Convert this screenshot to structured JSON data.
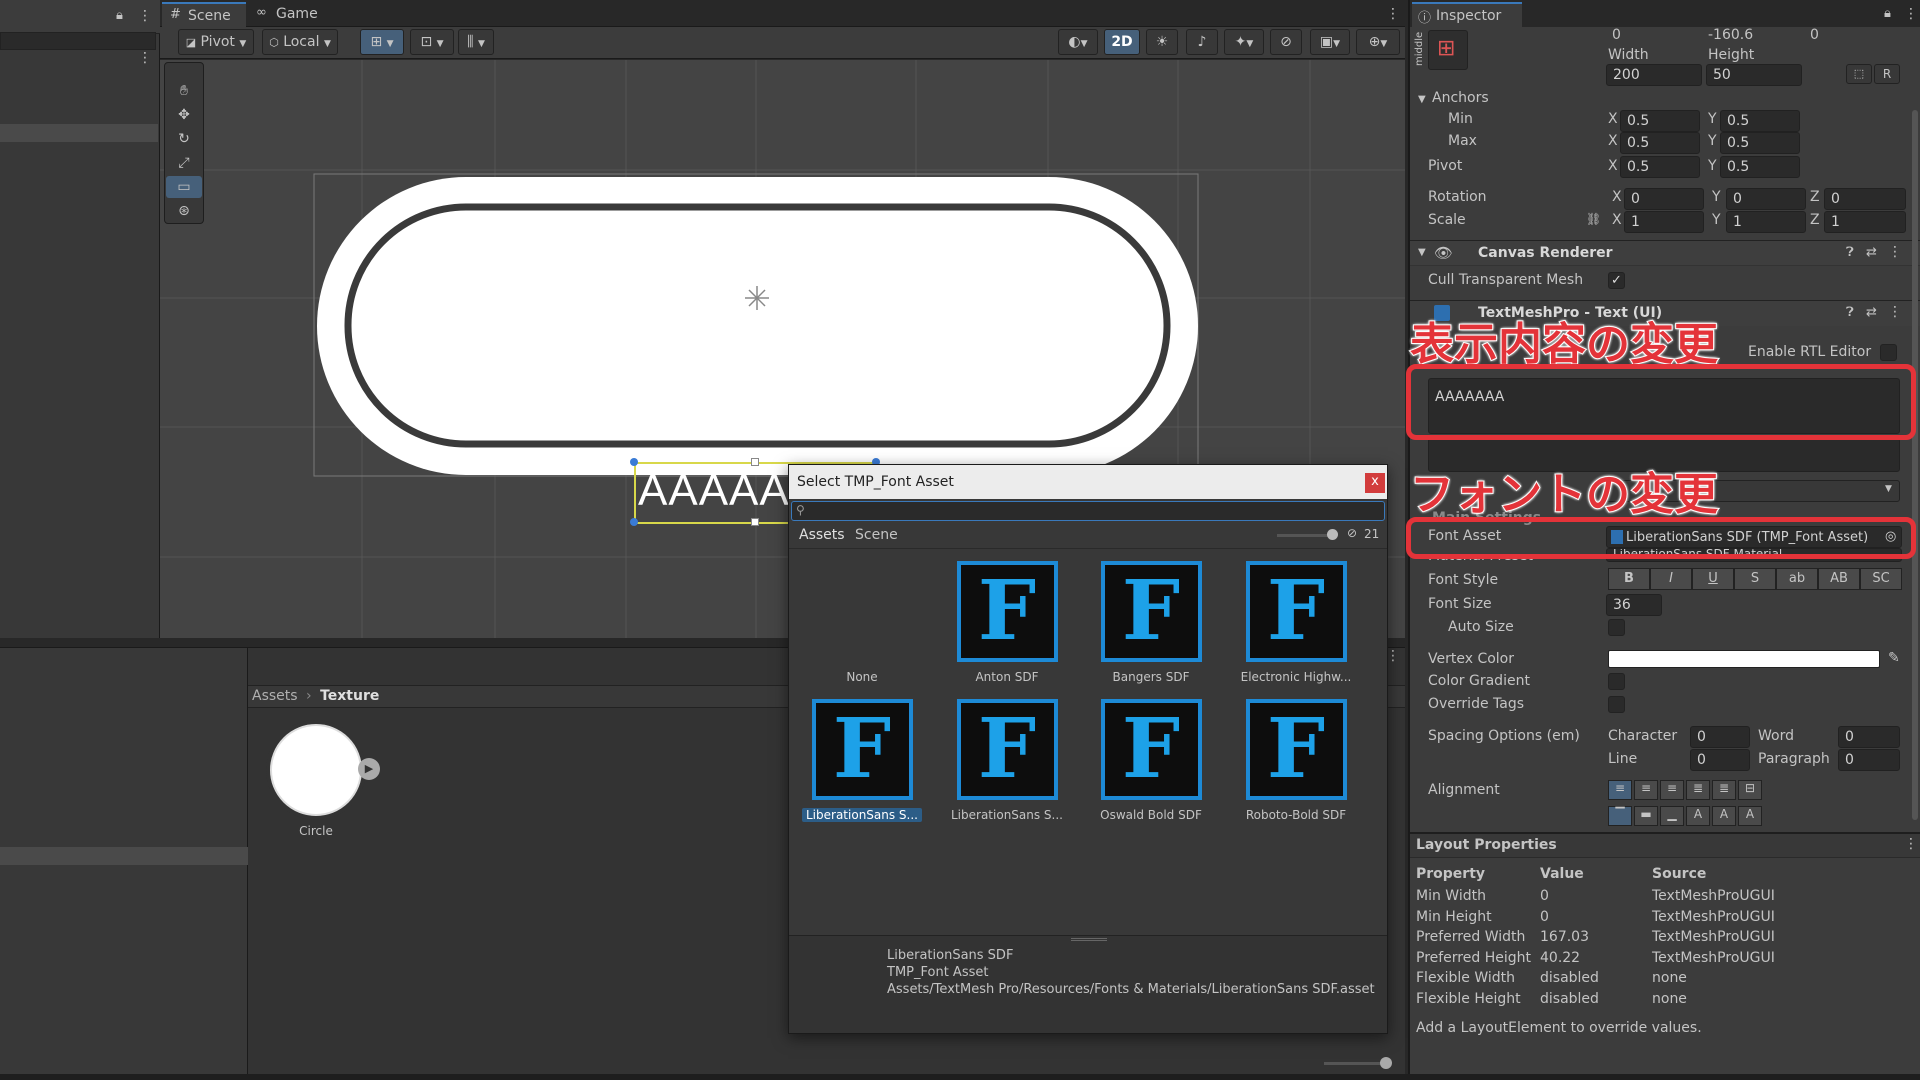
{
  "scene_tabs": {
    "scene": "Scene",
    "game": "Game"
  },
  "scene_toolbar": {
    "pivot": "Pivot",
    "local": "Local",
    "mode_2d": "2D"
  },
  "project": {
    "breadcrumb_root": "Assets",
    "breadcrumb_folder": "Texture",
    "item_label": "Circle"
  },
  "scene_text_object": "AAAAAAA",
  "picker": {
    "title": "Select TMP_Font Asset",
    "close": "x",
    "search_placeholder": "",
    "tab_assets": "Assets",
    "tab_scene": "Scene",
    "count": "21",
    "items": [
      {
        "label": "None",
        "icon": "F"
      },
      {
        "label": "Anton SDF",
        "icon": "F"
      },
      {
        "label": "Bangers SDF",
        "icon": "F"
      },
      {
        "label": "Electronic Highw...",
        "icon": "F"
      },
      {
        "label": "LiberationSans S...",
        "icon": "F"
      },
      {
        "label": "LiberationSans S...",
        "icon": "F"
      },
      {
        "label": "Oswald Bold SDF",
        "icon": "F"
      },
      {
        "label": "Roboto-Bold SDF",
        "icon": "F"
      }
    ],
    "info_name": "LiberationSans SDF",
    "info_type": "TMP_Font Asset",
    "info_path": "Assets/TextMesh Pro/Resources/Fonts & Materials/LiberationSans SDF.asset"
  },
  "inspector": {
    "title": "Inspector",
    "anchor_preset_label": "middle",
    "pos_values": [
      "0",
      "-160.6",
      "0"
    ],
    "width_label": "Width",
    "height_label": "Height",
    "width": "200",
    "height": "50",
    "r_button": "R",
    "anchors_label": "Anchors",
    "min_label": "Min",
    "max_label": "Max",
    "pivot_label": "Pivot",
    "x": "X",
    "y": "Y",
    "z": "Z",
    "min_x": "0.5",
    "min_y": "0.5",
    "max_x": "0.5",
    "max_y": "0.5",
    "pivot_x": "0.5",
    "pivot_y": "0.5",
    "rotation_label": "Rotation",
    "rot_x": "0",
    "rot_y": "0",
    "rot_z": "0",
    "scale_label": "Scale",
    "scale_x": "1",
    "scale_y": "1",
    "scale_z": "1",
    "canvas_renderer": "Canvas Renderer",
    "cull_label": "Cull Transparent Mesh",
    "check": "✓",
    "tmp_component": "TextMeshPro - Text (UI)",
    "enable_rtl": "Enable RTL Editor",
    "text_value": "AAAAAAA",
    "main_settings": "Main Settings",
    "font_asset_label": "Font Asset",
    "font_asset_value": "LiberationSans SDF (TMP_Font Asset)",
    "material_preset_label": "Material Preset",
    "material_preset_value": "LiberationSans SDF Material",
    "font_style_label": "Font Style",
    "font_style_buttons": [
      "B",
      "I",
      "U",
      "S",
      "ab",
      "AB",
      "SC"
    ],
    "font_size_label": "Font Size",
    "font_size": "36",
    "auto_size_label": "Auto Size",
    "vertex_color_label": "Vertex Color",
    "color_gradient_label": "Color Gradient",
    "override_tags_label": "Override Tags",
    "spacing_label": "Spacing Options (em)",
    "character_label": "Character",
    "character": "0",
    "word_label": "Word",
    "word": "0",
    "line_label": "Line",
    "line": "0",
    "paragraph_label": "Paragraph",
    "paragraph": "0",
    "alignment_label": "Alignment"
  },
  "layout_properties": {
    "title": "Layout Properties",
    "header": [
      "Property",
      "Value",
      "Source"
    ],
    "rows": [
      [
        "Min Width",
        "0",
        "TextMeshProUGUI"
      ],
      [
        "Min Height",
        "0",
        "TextMeshProUGUI"
      ],
      [
        "Preferred Width",
        "167.03",
        "TextMeshProUGUI"
      ],
      [
        "Preferred Height",
        "40.22",
        "TextMeshProUGUI"
      ],
      [
        "Flexible Width",
        "disabled",
        "none"
      ],
      [
        "Flexible Height",
        "disabled",
        "none"
      ]
    ],
    "footer": "Add a LayoutElement to override values."
  },
  "annotations": {
    "content_change": "表示内容の変更",
    "font_change": "フォントの変更"
  },
  "colors": {
    "accent": "#1d8ad6",
    "annotation_red": "#e43339",
    "selection": "#2c5d87"
  },
  "icons": [
    "lock-icon",
    "menu-dots-icon",
    "hand-tool-icon",
    "move-tool-icon",
    "rotate-tool-icon",
    "scale-tool-icon",
    "rect-tool-icon",
    "transform-tool-icon",
    "grid-icon",
    "snap-icon",
    "eye-icon",
    "help-icon",
    "preset-icon",
    "eyedropper-icon",
    "target-icon",
    "search-icon",
    "play-icon"
  ]
}
